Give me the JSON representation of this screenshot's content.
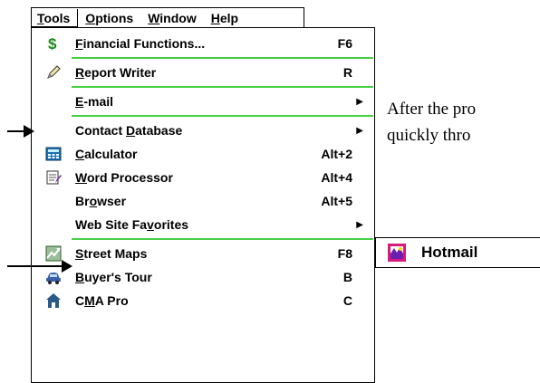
{
  "menubar": {
    "items": [
      {
        "label": "Tools",
        "mnemonic": "T",
        "rest": "ools"
      },
      {
        "label": "Options",
        "mnemonic": "O",
        "rest": "ptions"
      },
      {
        "label": "Window",
        "mnemonic": "W",
        "rest": "indow"
      },
      {
        "label": "Help",
        "mnemonic": "H",
        "rest": "elp"
      }
    ]
  },
  "menu": {
    "items": [
      {
        "label": "Financial Functions...",
        "pre": "",
        "mn": "F",
        "post": "inancial Functions...",
        "shortcut": "F6",
        "icon": "dollar-icon",
        "submenu": false
      },
      {
        "label": "Report Writer",
        "pre": "",
        "mn": "R",
        "post": "eport Writer",
        "shortcut": "R",
        "icon": "pencil-icon",
        "submenu": false
      },
      {
        "label": "E-mail",
        "pre": "",
        "mn": "E",
        "post": "-mail",
        "shortcut": "",
        "icon": "",
        "submenu": true
      },
      {
        "label": "Contact Database",
        "pre": "Contact ",
        "mn": "D",
        "post": "atabase",
        "shortcut": "",
        "icon": "",
        "submenu": true
      },
      {
        "label": "Calculator",
        "pre": "",
        "mn": "C",
        "post": "alculator",
        "shortcut": "Alt+2",
        "icon": "calculator-icon",
        "submenu": false
      },
      {
        "label": "Word Processor",
        "pre": "",
        "mn": "W",
        "post": "ord Processor",
        "shortcut": "Alt+4",
        "icon": "notepad-icon",
        "submenu": false
      },
      {
        "label": "Browser",
        "pre": "Br",
        "mn": "o",
        "post": "wser",
        "shortcut": "Alt+5",
        "icon": "",
        "submenu": false
      },
      {
        "label": "Web Site Favorites",
        "pre": "Web Site Fa",
        "mn": "v",
        "post": "orites",
        "shortcut": "",
        "icon": "",
        "submenu": true
      },
      {
        "label": "Street Maps",
        "pre": "",
        "mn": "S",
        "post": "treet Maps",
        "shortcut": "F8",
        "icon": "map-icon",
        "submenu": false
      },
      {
        "label": "Buyer's Tour",
        "pre": "",
        "mn": "B",
        "post": "uyer's Tour",
        "shortcut": "B",
        "icon": "car-icon",
        "submenu": false
      },
      {
        "label": "CMA Pro",
        "pre": "C",
        "mn": "M",
        "post": "A Pro",
        "shortcut": "C",
        "icon": "house-icon",
        "submenu": false
      }
    ]
  },
  "submenu": {
    "label": "Hotmail",
    "icon": "hotmail-icon"
  },
  "side_text": {
    "line1": "After the pro",
    "line2": "quickly thro"
  },
  "colors": {
    "separator": "#46d046",
    "dollar": "#1a8a1a"
  }
}
